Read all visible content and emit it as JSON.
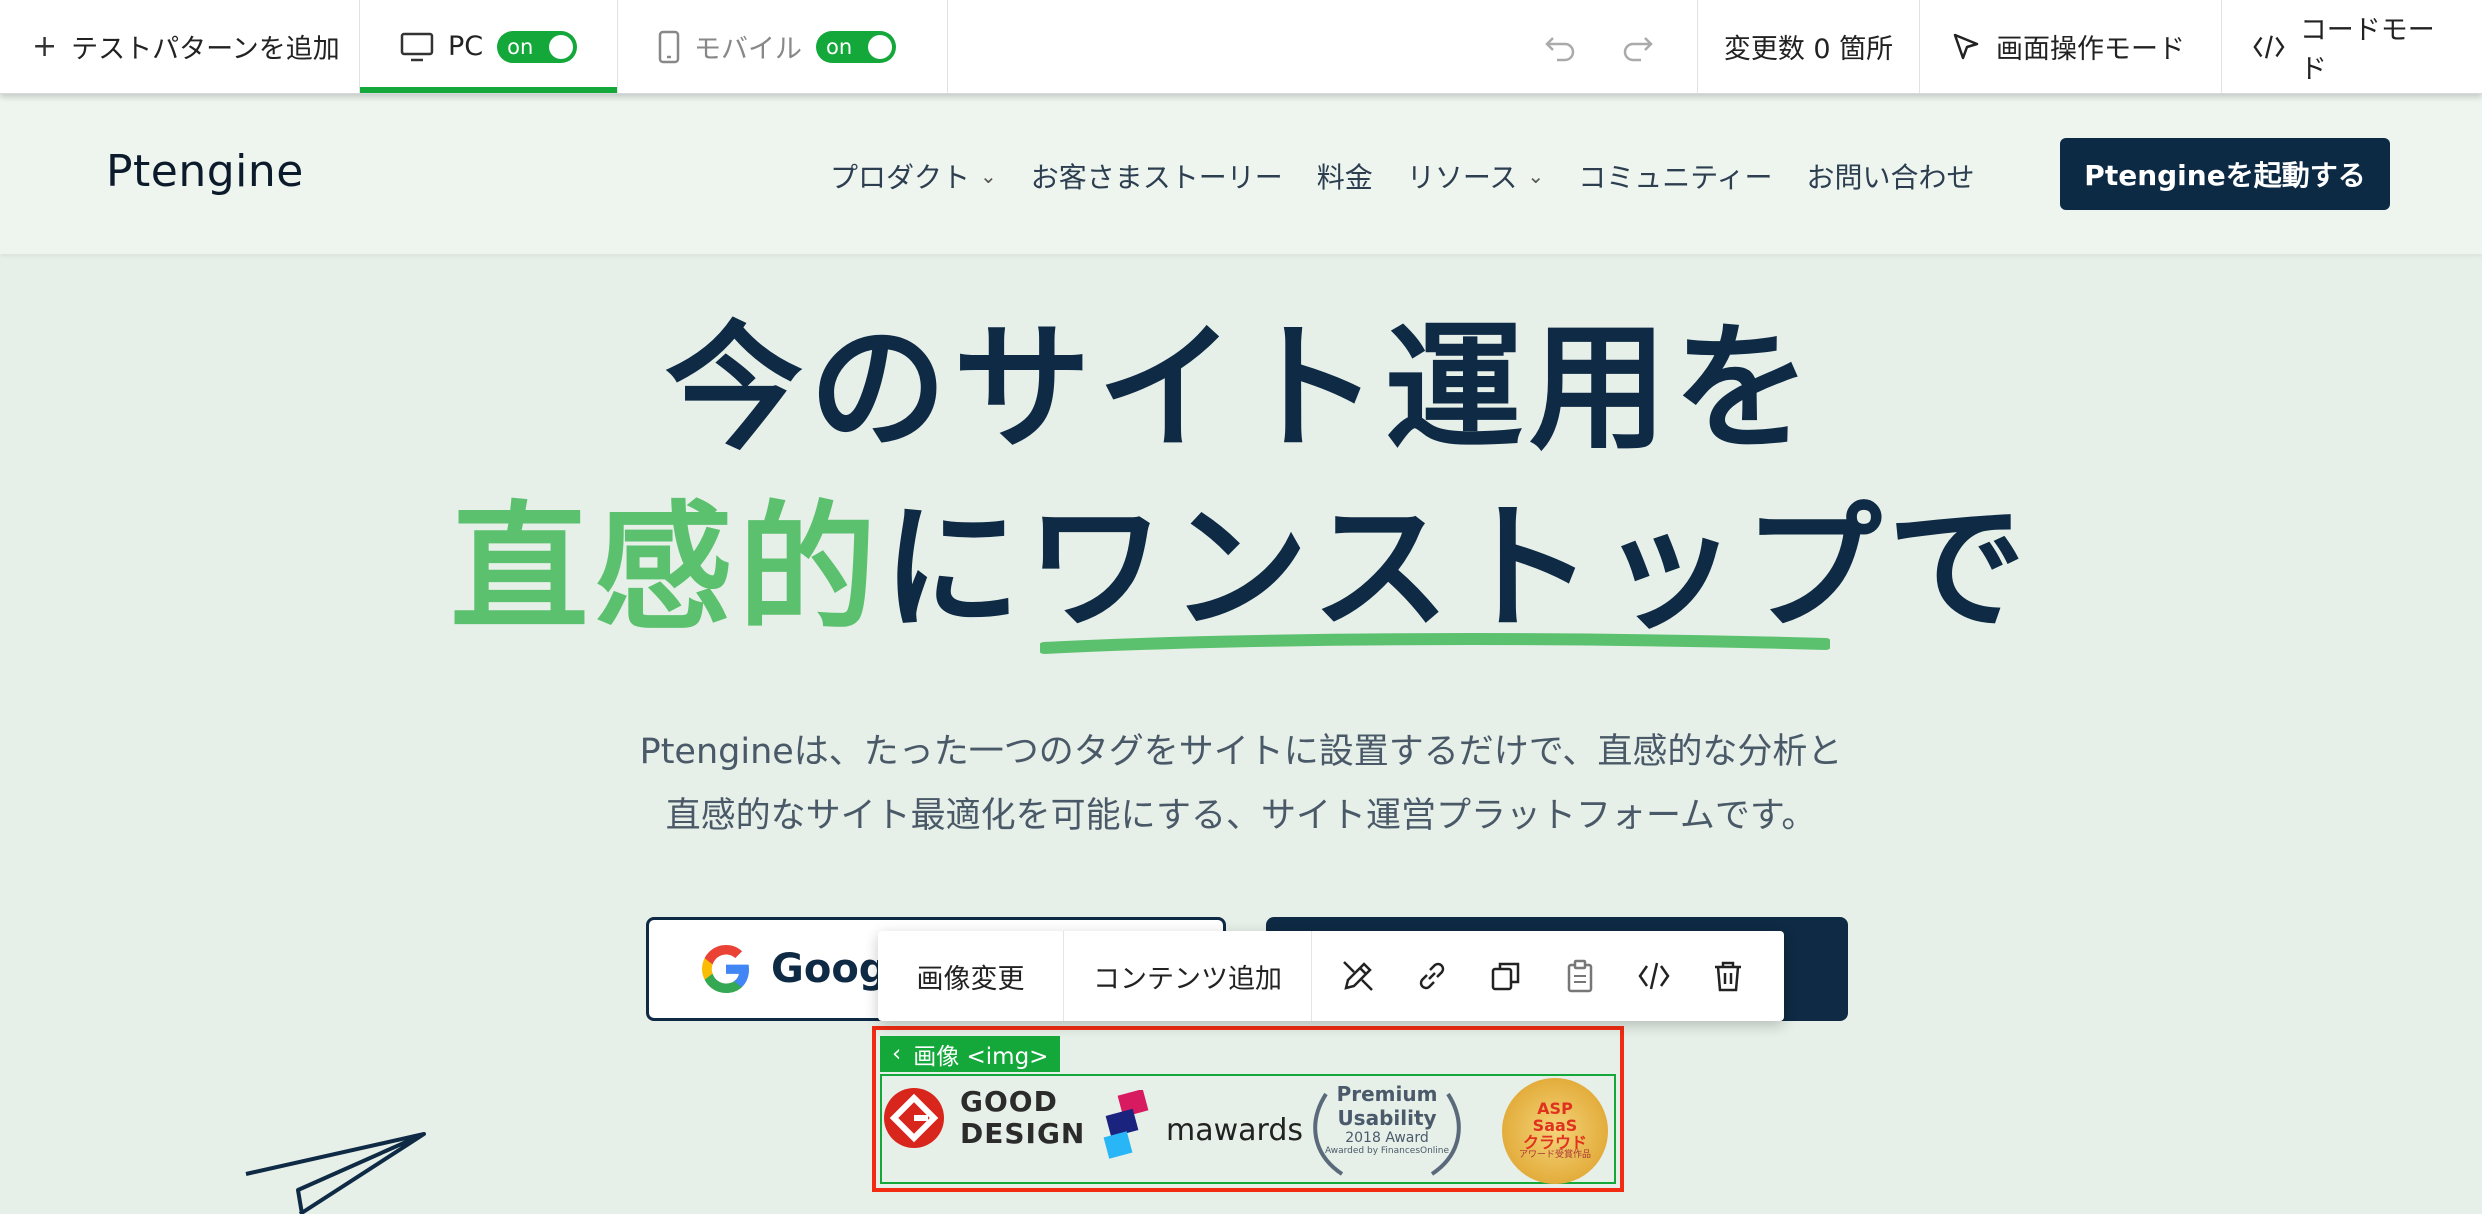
{
  "editor_bar": {
    "add_pattern": "テストパターンを追加",
    "pc_label": "PC",
    "pc_toggle": "on",
    "mobile_label": "モバイル",
    "mobile_toggle": "on",
    "changes": "変更数 0 箇所",
    "visual_mode": "画面操作モード",
    "code_mode": "コードモード"
  },
  "site": {
    "logo": "Ptengine",
    "nav": [
      {
        "label": "プロダクト",
        "dropdown": true
      },
      {
        "label": "お客さまストーリー",
        "dropdown": false
      },
      {
        "label": "料金",
        "dropdown": false
      },
      {
        "label": "リソース",
        "dropdown": true
      },
      {
        "label": "コミュニティー",
        "dropdown": false
      },
      {
        "label": "お問い合わせ",
        "dropdown": false
      }
    ],
    "launch_button": "Ptengineを起動する"
  },
  "hero": {
    "line1": "今のサイト運用を",
    "line2_green": "直感的",
    "line2_mid": "に",
    "line2_underlined": "ワンストップ",
    "line2_end": "で",
    "sub1": "Ptengineは、たった一つのタグをサイトに設置するだけで、直感的な分析と",
    "sub2": "直感的なサイト最適化を可能にする、サイト運営プラットフォームです。",
    "google_button": "Google"
  },
  "element_toolbar": {
    "change_image": "画像変更",
    "add_content": "コンテンツ追加"
  },
  "selection": {
    "tag": "画像 <img>"
  },
  "awards": {
    "good_design": [
      "GOOD",
      "DESIGN"
    ],
    "mawards": "mawards",
    "premium": [
      "Premium",
      "Usability",
      "2018 Award",
      "Awarded by FinancesOnline"
    ],
    "asp": [
      "ASP",
      "SaaS",
      "クラウド",
      "アワード受賞作品"
    ]
  },
  "colors": {
    "accent_green": "#14a83b",
    "brand_navy": "#0e2a44",
    "hero_green": "#5cc16e",
    "selection_red": "#f12c13"
  }
}
